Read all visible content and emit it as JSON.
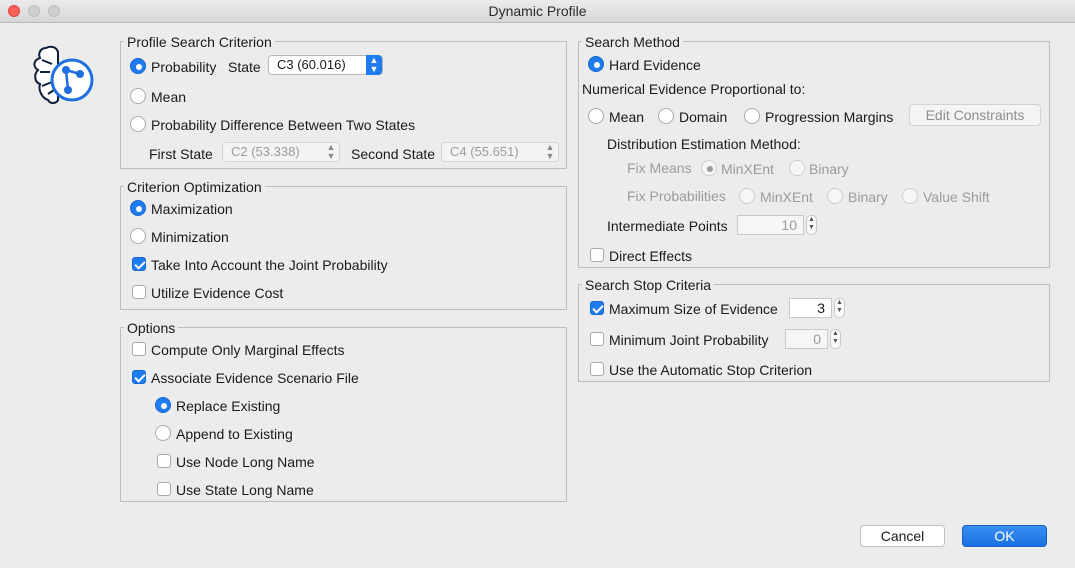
{
  "window": {
    "title": "Dynamic Profile"
  },
  "profile": {
    "group_title": "Profile Search Criterion",
    "probability_label": "Probability",
    "state_label": "State",
    "state_value": "C3 (60.016)",
    "mean_label": "Mean",
    "diff_label": "Probability Difference Between Two States",
    "first_state_label": "First State",
    "first_state_value": "C2 (53.338)",
    "second_state_label": "Second State",
    "second_state_value": "C4 (55.651)"
  },
  "criterion": {
    "group_title": "Criterion Optimization",
    "max_label": "Maximization",
    "min_label": "Minimization",
    "joint_label": "Take Into Account the Joint Probability",
    "cost_label": "Utilize Evidence Cost"
  },
  "options": {
    "group_title": "Options",
    "marginal_label": "Compute Only Marginal Effects",
    "scenario_label": "Associate Evidence Scenario File",
    "replace_label": "Replace Existing",
    "append_label": "Append to Existing",
    "node_long_label": "Use Node Long Name",
    "state_long_label": "Use State Long Name"
  },
  "search_method": {
    "group_title": "Search Method",
    "hard_label": "Hard Evidence",
    "numerical_label": "Numerical Evidence Proportional to:",
    "mean_label": "Mean",
    "domain_label": "Domain",
    "progression_label": "Progression Margins",
    "edit_constraints_label": "Edit Constraints",
    "distribution_label": "Distribution Estimation Method:",
    "fix_means_label": "Fix Means",
    "minxent_label": "MinXEnt",
    "binary_label": "Binary",
    "fix_prob_label": "Fix Probabilities",
    "value_shift_label": "Value Shift",
    "intermediate_label": "Intermediate Points",
    "intermediate_value": "10",
    "direct_label": "Direct Effects"
  },
  "stop": {
    "group_title": "Search Stop Criteria",
    "max_size_label": "Maximum Size of Evidence",
    "max_size_value": "3",
    "min_joint_label": "Minimum Joint Probability",
    "min_joint_value": "0",
    "auto_label": "Use the Automatic Stop Criterion"
  },
  "buttons": {
    "cancel": "Cancel",
    "ok": "OK"
  },
  "icons": {
    "app": "bayesian-network-icon"
  },
  "colors": {
    "accent": "#1e7cf0",
    "close": "#fe5f57"
  }
}
